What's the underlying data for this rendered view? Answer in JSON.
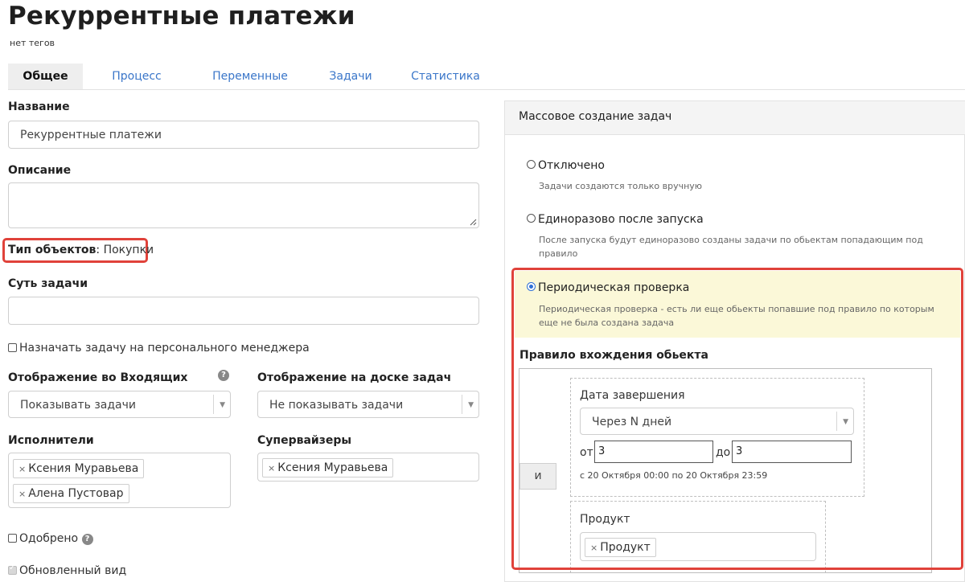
{
  "page": {
    "title": "Рекуррентные платежи",
    "tags_text": "нет тегов"
  },
  "tabs": [
    {
      "label": "Общее",
      "active": true
    },
    {
      "label": "Процесс",
      "active": false
    },
    {
      "label": "Переменные",
      "active": false
    },
    {
      "label": "Задачи",
      "active": false
    },
    {
      "label": "Статистика",
      "active": false
    }
  ],
  "form": {
    "name_label": "Название",
    "name_value": "Рекуррентные платежи",
    "description_label": "Описание",
    "description_value": "",
    "object_type_label": "Тип объектов",
    "object_type_sep": ":",
    "object_type_value": "Покупки",
    "task_essence_label": "Суть задачи",
    "task_essence_value": "",
    "assign_personal_manager_label": "Назначать задачу на персонального менеджера",
    "assign_personal_manager_checked": false,
    "inbox_display_label": "Отображение во Входящих",
    "inbox_display_value": "Показывать задачи",
    "board_display_label": "Отображение на доске задач",
    "board_display_value": "Не показывать задачи",
    "executors_label": "Исполнители",
    "executors": [
      "Ксения Муравьева",
      "Алена Пустовар"
    ],
    "supervisors_label": "Супервайзеры",
    "supervisors": [
      "Ксения Муравьева"
    ],
    "approved_label": "Одобрено",
    "approved_checked": false,
    "updated_view_label": "Обновленный вид",
    "updated_view_checked": true,
    "help_glyph": "?",
    "remove_glyph": "×",
    "dropdown_glyph": "▼"
  },
  "mass_creation": {
    "header": "Массовое создание задач",
    "options": [
      {
        "title": "Отключено",
        "desc": "Задачи создаются только вручную",
        "selected": false
      },
      {
        "title": "Единоразово после запуска",
        "desc": "После запуска будут единоразово созданы задачи по обьектам попадающим под правило",
        "selected": false
      },
      {
        "title": "Периодическая проверка",
        "desc": "Периодическая проверка - есть ли еще обьекты попавшие под правило по которым еще не была создана задача",
        "selected": true
      }
    ],
    "rule_title": "Правило вхождения обьекта",
    "and_button": "и",
    "completion_date_label": "Дата завершения",
    "completion_date_mode": "Через N дней",
    "from_label": "от",
    "from_value": "3",
    "to_label": "до",
    "to_value": "3",
    "date_range_text": "с 20 Октября 00:00 по 20 Октября 23:59",
    "product_label": "Продукт",
    "product_tags": [
      "Продукт"
    ]
  },
  "colors": {
    "accent_link": "#3a76c9",
    "highlight_red": "#e0423a",
    "selected_option_bg": "#fbf8d8",
    "radio_blue": "#2f6fd6"
  }
}
